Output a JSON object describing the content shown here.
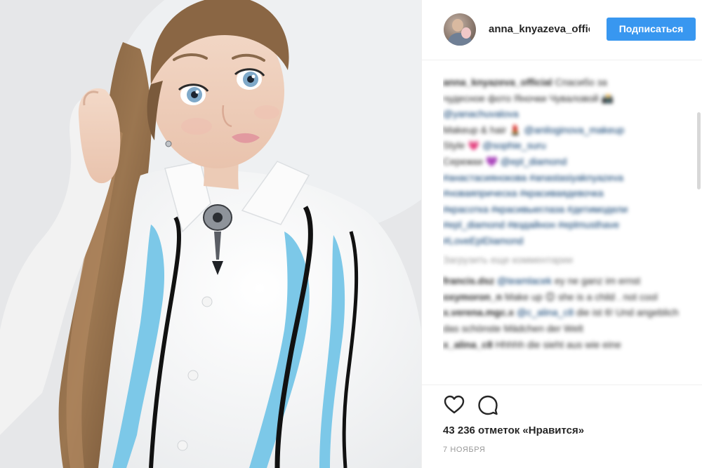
{
  "post": {
    "username": "anna_knyazeva_official",
    "follow_label": "Подписаться",
    "likes_text": "43 236 отметок «Нравится»",
    "date_text": "7 НОЯБРЯ"
  },
  "caption": {
    "user": "anna_knyazeva_official",
    "line1": "Спасибо за",
    "line2": "чудесное фото Яночки Чуваловой 📸",
    "mention1": "@yanachuvalova",
    "makeup_prefix": "Makeup & hair 💄",
    "makeup_mention": "@aniloginova_makeup",
    "style_prefix": "Style 💗",
    "style_mention": "@sophie_suru",
    "earrings_prefix": "Сережки 💜",
    "earrings_mention": "@epl_diamond",
    "tags_line1": "#анастасиянокова #anastasiyaknyazeva",
    "tags_line2": "#новаяприческа #красиваядевочка",
    "tags_line3": "#красотка #красивыеглаза #детимодели",
    "tags_line4": "#epl_diamond #вздайнон #eplmusthave",
    "tags_line5": "#LoveEplDiamond"
  },
  "load_more": "Загрузить еще комментарии",
  "comments": [
    {
      "user": "francis.dsz",
      "mention": "@teamlacek",
      "text": "ey ne ganz im ernst"
    },
    {
      "user": "oxymoron_n",
      "mention": "",
      "text": "Make up 😊 she is a child . not cool"
    },
    {
      "user": "x.verena.mgc.x",
      "mention": "@c_alina_c8",
      "text": "die ist 6! Und angeblich das schönste Mädchen der Welt"
    },
    {
      "user": "x_alina_c8",
      "mention": "",
      "text": "Hhhhh die sieht aus wie eine"
    }
  ],
  "icons": {
    "like": "heart-icon",
    "comment": "comment-icon"
  },
  "colors": {
    "follow_button": "#3897f0",
    "link": "#003569",
    "muted": "#999999"
  }
}
